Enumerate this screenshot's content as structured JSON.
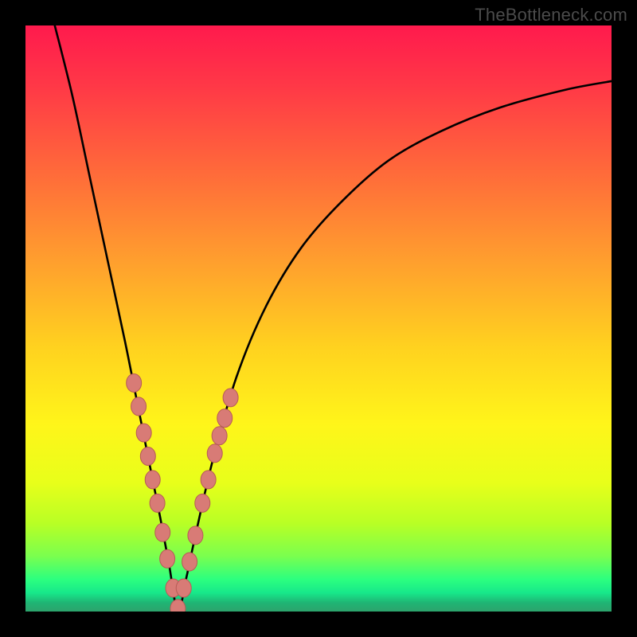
{
  "watermark": {
    "text": "TheBottleneck.com"
  },
  "colors": {
    "frame": "#000000",
    "curve": "#000000",
    "marker_fill": "#d87b76",
    "marker_stroke": "#b65b56",
    "gradient_stops": [
      {
        "offset": 0.0,
        "color": "#ff1a4d"
      },
      {
        "offset": 0.1,
        "color": "#ff3747"
      },
      {
        "offset": 0.25,
        "color": "#ff6a3a"
      },
      {
        "offset": 0.4,
        "color": "#ff9e2e"
      },
      {
        "offset": 0.55,
        "color": "#ffd21f"
      },
      {
        "offset": 0.68,
        "color": "#fff51a"
      },
      {
        "offset": 0.78,
        "color": "#e8ff1a"
      },
      {
        "offset": 0.85,
        "color": "#b8ff25"
      },
      {
        "offset": 0.905,
        "color": "#7bff4e"
      },
      {
        "offset": 0.945,
        "color": "#2cff7f"
      },
      {
        "offset": 0.968,
        "color": "#17e88a"
      },
      {
        "offset": 0.985,
        "color": "#1fb574"
      },
      {
        "offset": 1.0,
        "color": "#2da36c"
      }
    ]
  },
  "chart_data": {
    "type": "line",
    "title": "",
    "xlabel": "",
    "ylabel": "",
    "xlim": [
      0,
      100
    ],
    "ylim": [
      0,
      100
    ],
    "x_optimum": 26,
    "series": [
      {
        "name": "bottleneck-curve",
        "x": [
          5,
          8,
          11,
          14,
          17,
          19,
          21,
          23,
          24.5,
          26,
          27.5,
          29,
          32,
          36,
          41,
          47,
          54,
          62,
          71,
          81,
          92,
          100
        ],
        "values": [
          100,
          88,
          74,
          60,
          46,
          36,
          26,
          16,
          8,
          0,
          6,
          13,
          26,
          40,
          52,
          62,
          70,
          77,
          82,
          86,
          89,
          90.5
        ]
      }
    ],
    "markers": {
      "name": "sample-points",
      "x": [
        18.5,
        19.3,
        20.2,
        20.9,
        21.7,
        22.5,
        23.4,
        24.2,
        25.2,
        26.0,
        27.0,
        28.0,
        29.0,
        30.2,
        31.2,
        32.3,
        33.1,
        34.0,
        35.0
      ],
      "values": [
        39.0,
        35.0,
        30.5,
        26.5,
        22.5,
        18.5,
        13.5,
        9.0,
        4.0,
        0.5,
        4.0,
        8.5,
        13.0,
        18.5,
        22.5,
        27.0,
        30.0,
        33.0,
        36.5
      ]
    }
  }
}
